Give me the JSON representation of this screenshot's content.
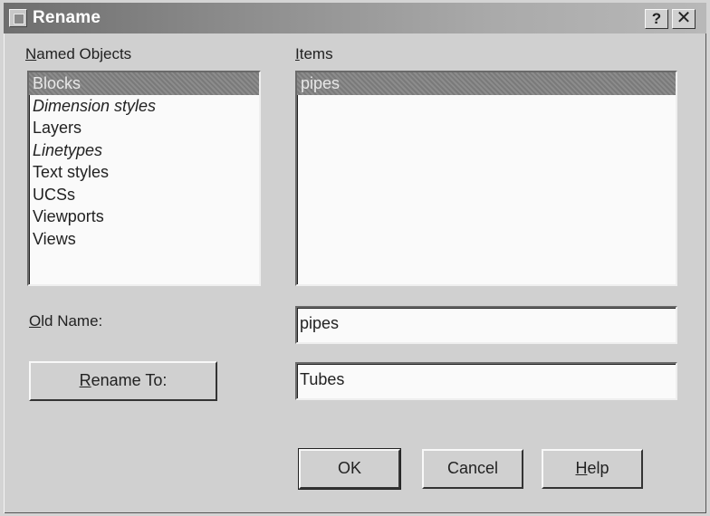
{
  "window": {
    "title": "Rename",
    "help_button": "?",
    "close_button": "✕"
  },
  "named_objects": {
    "label": "Named Objects",
    "label_access_key": "N",
    "label_rest": "amed Objects",
    "items": [
      {
        "label": "Blocks",
        "italic": false
      },
      {
        "label": "Dimension styles",
        "italic": true
      },
      {
        "label": "Layers",
        "italic": false
      },
      {
        "label": "Linetypes",
        "italic": true
      },
      {
        "label": "Text styles",
        "italic": false
      },
      {
        "label": "UCSs",
        "italic": false
      },
      {
        "label": "Viewports",
        "italic": false
      },
      {
        "label": "Views",
        "italic": false
      }
    ],
    "selected": "Blocks"
  },
  "items": {
    "label": "Items",
    "label_access_key": "I",
    "label_rest": "tems",
    "list": [
      {
        "label": "pipes"
      }
    ],
    "selected": "pipes"
  },
  "old_name": {
    "label_access_key": "O",
    "label_rest": "ld Name:",
    "value": "pipes"
  },
  "rename_to": {
    "button_access_key": "R",
    "button_rest": "ename To:",
    "value": "Tubes"
  },
  "buttons": {
    "ok": "OK",
    "cancel": "Cancel",
    "help_access_key": "H",
    "help_rest": "elp"
  }
}
